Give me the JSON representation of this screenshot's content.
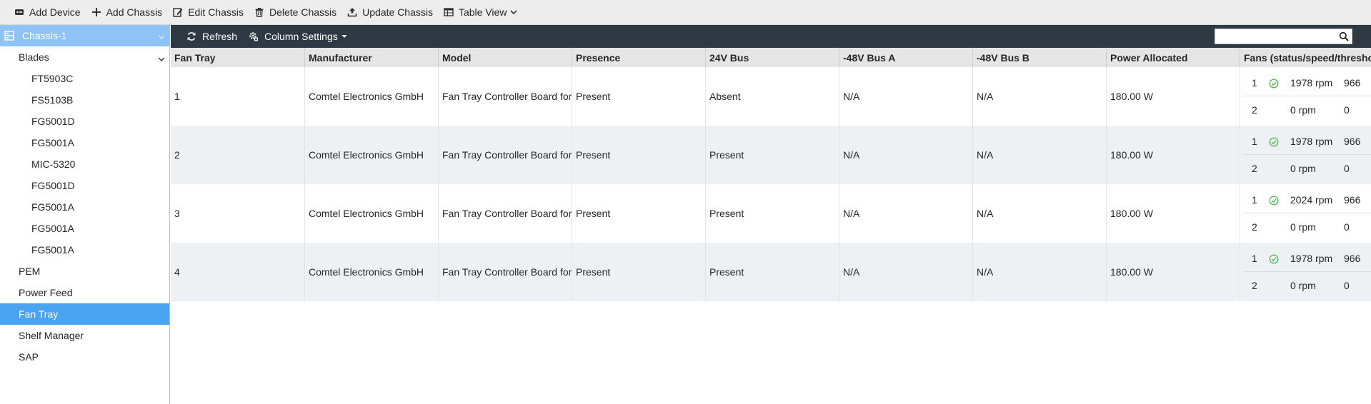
{
  "toolbar": {
    "add_device": "Add Device",
    "add_chassis": "Add Chassis",
    "edit_chassis": "Edit Chassis",
    "delete_chassis": "Delete Chassis",
    "update_chassis": "Update Chassis",
    "table_view": "Table View"
  },
  "sidebar": {
    "root": "Chassis-1",
    "blades_label": "Blades",
    "blades": [
      "FT5903C",
      "FS5103B",
      "FG5001D",
      "FG5001A",
      "MIC-5320",
      "FG5001D",
      "FG5001A",
      "FG5001A",
      "FG5001A"
    ],
    "items": [
      "PEM",
      "Power Feed",
      "Fan Tray",
      "Shelf Manager",
      "SAP"
    ],
    "active_item": "Fan Tray"
  },
  "subbar": {
    "refresh": "Refresh",
    "column_settings": "Column Settings",
    "search_placeholder": "",
    "search_value": ""
  },
  "table": {
    "columns": [
      "Fan Tray",
      "Manufacturer",
      "Model",
      "Presence",
      "24V Bus",
      "-48V Bus A",
      "-48V Bus B",
      "Power Allocated",
      "Fans (status/speed/threshold)"
    ],
    "rows": [
      {
        "fan_tray": "1",
        "manufacturer": "Comtel Electronics GmbH",
        "model": "Fan Tray Controller Board for A",
        "presence": "Present",
        "bus24": "Absent",
        "busA": "N/A",
        "busB": "N/A",
        "power": "180.00 W",
        "fans": [
          {
            "idx": "1",
            "status": "ok",
            "speed": "1978 rpm",
            "threshold": "966"
          },
          {
            "idx": "2",
            "status": "",
            "speed": "0 rpm",
            "threshold": "0"
          }
        ]
      },
      {
        "fan_tray": "2",
        "manufacturer": "Comtel Electronics GmbH",
        "model": "Fan Tray Controller Board for A",
        "presence": "Present",
        "bus24": "Present",
        "busA": "N/A",
        "busB": "N/A",
        "power": "180.00 W",
        "fans": [
          {
            "idx": "1",
            "status": "ok",
            "speed": "1978 rpm",
            "threshold": "966"
          },
          {
            "idx": "2",
            "status": "",
            "speed": "0 rpm",
            "threshold": "0"
          }
        ]
      },
      {
        "fan_tray": "3",
        "manufacturer": "Comtel Electronics GmbH",
        "model": "Fan Tray Controller Board for A",
        "presence": "Present",
        "bus24": "Present",
        "busA": "N/A",
        "busB": "N/A",
        "power": "180.00 W",
        "fans": [
          {
            "idx": "1",
            "status": "ok",
            "speed": "2024 rpm",
            "threshold": "966"
          },
          {
            "idx": "2",
            "status": "",
            "speed": "0 rpm",
            "threshold": "0"
          }
        ]
      },
      {
        "fan_tray": "4",
        "manufacturer": "Comtel Electronics GmbH",
        "model": "Fan Tray Controller Board for A",
        "presence": "Present",
        "bus24": "Present",
        "busA": "N/A",
        "busB": "N/A",
        "power": "180.00 W",
        "fans": [
          {
            "idx": "1",
            "status": "ok",
            "speed": "1978 rpm",
            "threshold": "966"
          },
          {
            "idx": "2",
            "status": "",
            "speed": "0 rpm",
            "threshold": "0"
          }
        ]
      }
    ]
  },
  "colors": {
    "header_dark": "#2e3944",
    "selected": "#4aa3f0",
    "root_bg": "#8fc3f6",
    "ok_green": "#5cb85c"
  },
  "icons": [
    "add-device-icon",
    "plus-icon",
    "edit-icon",
    "trash-icon",
    "upload-icon",
    "table-icon",
    "refresh-icon",
    "gear-icon",
    "search-icon",
    "check-circle-icon"
  ]
}
